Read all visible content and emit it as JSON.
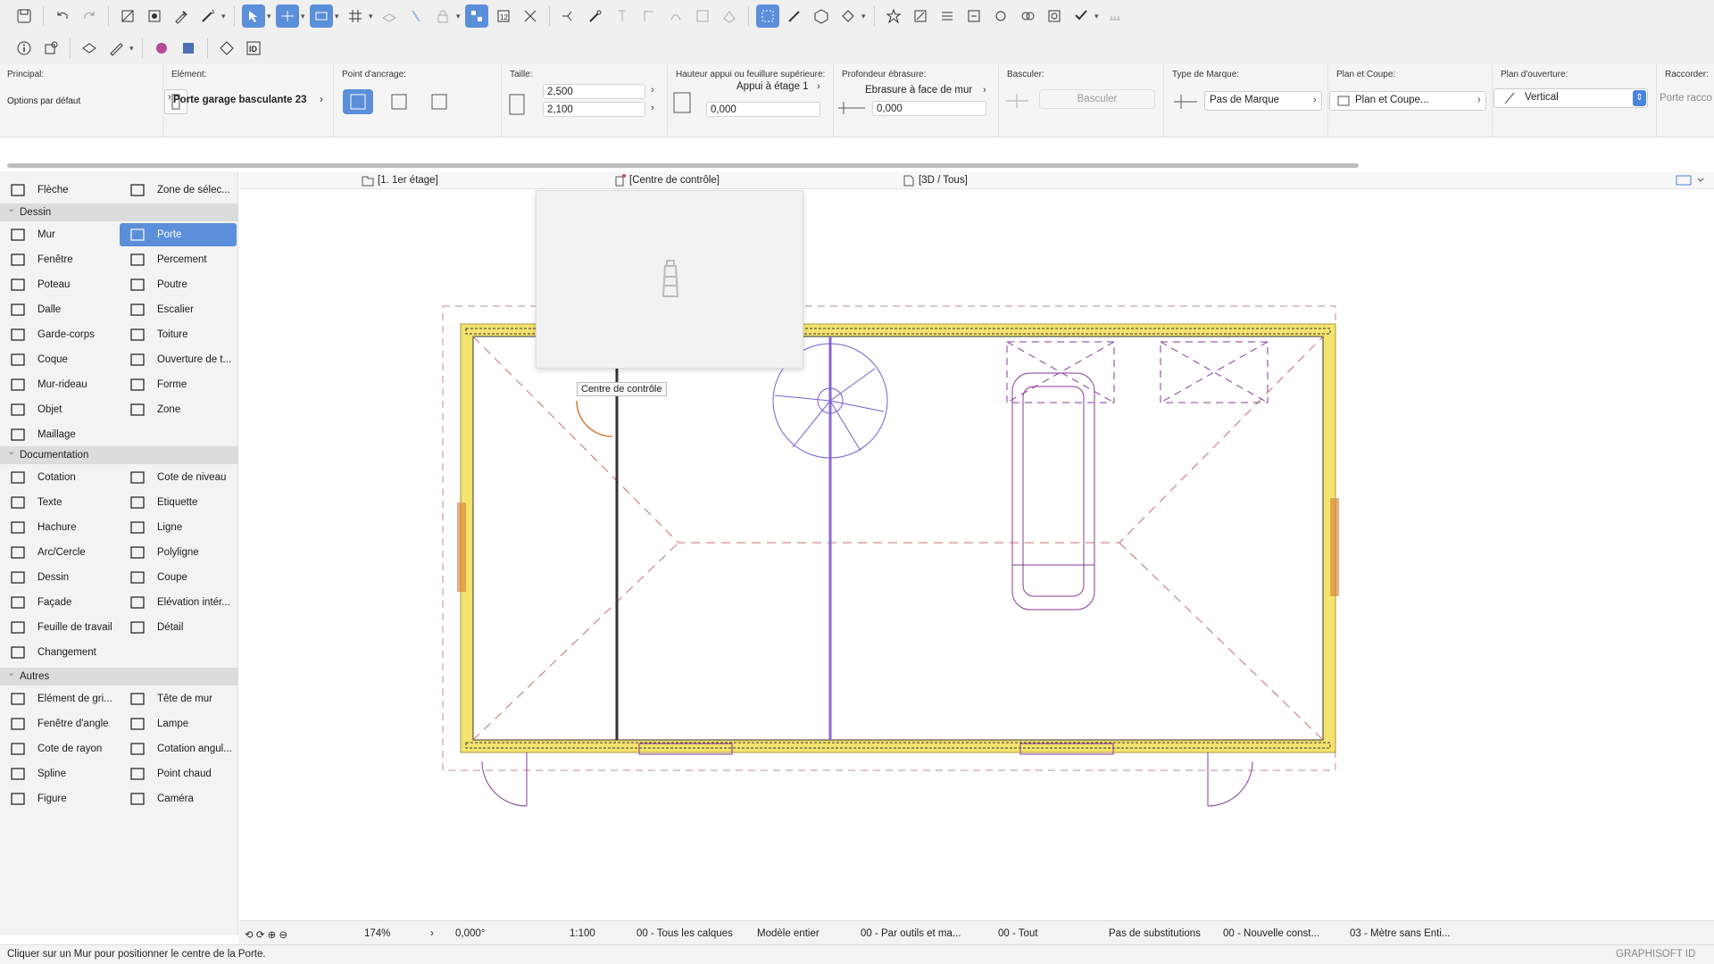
{
  "accent_color": "#5b8fd9",
  "toolbar1": {
    "icons": [
      "save-icon",
      "undo-icon",
      "redo-icon",
      "pick-up-params-icon",
      "inject-params-icon",
      "eyedropper-icon",
      "magic-wand-icon",
      "arrow-tool-icon",
      "guide-line-icon",
      "snap-icon",
      "grid-icon",
      "layers-icon",
      "lock-icon",
      "trace-icon",
      "renovation-icon",
      "explode-icon",
      "split-icon",
      "adjust-icon",
      "elevation-icon",
      "offset-icon",
      "rotate-icon",
      "mirror-icon",
      "marquee-icon",
      "edit-icon",
      "view-icon",
      "favorite-icon",
      "3d-document-icon",
      "layout-icon",
      "publish-icon",
      "markup-icon",
      "teamwork-icon",
      "check-icon",
      "tools-icon"
    ]
  },
  "toolbar2": {
    "icons": [
      "info-icon",
      "layer-settings-icon",
      "renovation-filter-icon",
      "pen-set-icon",
      "surface-icon",
      "graphic-override-icon",
      "morph-icon",
      "id-icon"
    ]
  },
  "infobox": {
    "principal": {
      "label": "Principal:",
      "value": "Options par défaut"
    },
    "element": {
      "label": "Elément:",
      "value": "Porte garage basculante 23"
    },
    "anchor": {
      "label": "Point d'ancrage:"
    },
    "size": {
      "label": "Taille:",
      "width": "2,500",
      "height": "2,100"
    },
    "sill": {
      "label": "Hauteur appui ou feuillure supérieure:",
      "ref": "Appui à étage 1",
      "value": "0,000"
    },
    "reveal": {
      "label": "Profondeur ébrasure:",
      "ref": "Ebrasure à face de mur",
      "value": "0,000"
    },
    "flip": {
      "label": "Basculer:",
      "button": "Basculer"
    },
    "marker": {
      "label": "Type de Marque:",
      "value": "Pas de Marque"
    },
    "plan_section": {
      "label": "Plan et Coupe:",
      "value": "Plan et Coupe..."
    },
    "opening_plan": {
      "label": "Plan d'ouverture:",
      "value": "Vertical"
    },
    "connect": {
      "label": "Raccorder:",
      "value": "Porte racco"
    }
  },
  "toolbox": {
    "top": [
      {
        "label": "Flèche",
        "icon": "arrow-icon"
      },
      {
        "label": "Zone de sélec...",
        "icon": "marquee-icon"
      }
    ],
    "dessin_title": "Dessin",
    "dessin": [
      {
        "label": "Mur",
        "icon": "wall-icon"
      },
      {
        "label": "Porte",
        "icon": "door-icon",
        "selected": true
      },
      {
        "label": "Fenêtre",
        "icon": "window-icon"
      },
      {
        "label": "Percement",
        "icon": "opening-icon"
      },
      {
        "label": "Poteau",
        "icon": "column-icon"
      },
      {
        "label": "Poutre",
        "icon": "beam-icon"
      },
      {
        "label": "Dalle",
        "icon": "slab-icon"
      },
      {
        "label": "Escalier",
        "icon": "stair-icon"
      },
      {
        "label": "Garde-corps",
        "icon": "railing-icon"
      },
      {
        "label": "Toiture",
        "icon": "roof-icon"
      },
      {
        "label": "Coque",
        "icon": "shell-icon"
      },
      {
        "label": "Ouverture de t...",
        "icon": "skylight-icon"
      },
      {
        "label": "Mur-rideau",
        "icon": "curtain-wall-icon"
      },
      {
        "label": "Forme",
        "icon": "morph-icon"
      },
      {
        "label": "Objet",
        "icon": "object-icon"
      },
      {
        "label": "Zone",
        "icon": "zone-icon"
      },
      {
        "label": "Maillage",
        "icon": "mesh-icon"
      }
    ],
    "documentation_title": "Documentation",
    "documentation": [
      {
        "label": "Cotation",
        "icon": "dimension-icon"
      },
      {
        "label": "Cote de niveau",
        "icon": "level-dimension-icon"
      },
      {
        "label": "Texte",
        "icon": "text-icon"
      },
      {
        "label": "Etiquette",
        "icon": "label-icon"
      },
      {
        "label": "Hachure",
        "icon": "fill-icon"
      },
      {
        "label": "Ligne",
        "icon": "line-icon"
      },
      {
        "label": "Arc/Cercle",
        "icon": "arc-icon"
      },
      {
        "label": "Polyligne",
        "icon": "polyline-icon"
      },
      {
        "label": "Dessin",
        "icon": "drawing-icon"
      },
      {
        "label": "Coupe",
        "icon": "section-icon"
      },
      {
        "label": "Façade",
        "icon": "elevation-icon"
      },
      {
        "label": "Elévation intér...",
        "icon": "interior-elevation-icon"
      },
      {
        "label": "Feuille de travail",
        "icon": "worksheet-icon"
      },
      {
        "label": "Détail",
        "icon": "detail-icon"
      },
      {
        "label": "Changement",
        "icon": "change-icon"
      }
    ],
    "autres_title": "Autres",
    "autres": [
      {
        "label": "Elément de gri...",
        "icon": "grid-element-icon"
      },
      {
        "label": "Tête de mur",
        "icon": "wall-end-icon"
      },
      {
        "label": "Fenêtre d'angle",
        "icon": "corner-window-icon"
      },
      {
        "label": "Lampe",
        "icon": "lamp-icon"
      },
      {
        "label": "Cote de rayon",
        "icon": "radial-dimension-icon"
      },
      {
        "label": "Cotation angul...",
        "icon": "angle-dimension-icon"
      },
      {
        "label": "Spline",
        "icon": "spline-icon"
      },
      {
        "label": "Point chaud",
        "icon": "hotspot-icon"
      },
      {
        "label": "Figure",
        "icon": "figure-icon"
      },
      {
        "label": "Caméra",
        "icon": "camera-icon"
      }
    ]
  },
  "tabs": [
    {
      "label": "[1. 1er étage]",
      "icon": "floor-plan-icon"
    },
    {
      "label": "[Centre de contrôle]",
      "icon": "control-center-icon"
    },
    {
      "label": "[3D / Tous]",
      "icon": "3d-view-icon"
    }
  ],
  "tooltip": "Centre de contrôle",
  "statusbar": {
    "zoom": "174%",
    "angle": "0,000°",
    "scale": "1:100",
    "layers": "00 - Tous les calques",
    "model": "Modèle entier",
    "pens": "00 - Par outils et ma...",
    "mvo": "00 - Tout",
    "override": "Pas de substitutions",
    "renovation": "00 - Nouvelle const...",
    "dimension": "03 - Mètre sans Enti..."
  },
  "hint": "Cliquer sur un Mur pour positionner le centre de la Porte.",
  "brand": "GRAPHISOFT ID"
}
